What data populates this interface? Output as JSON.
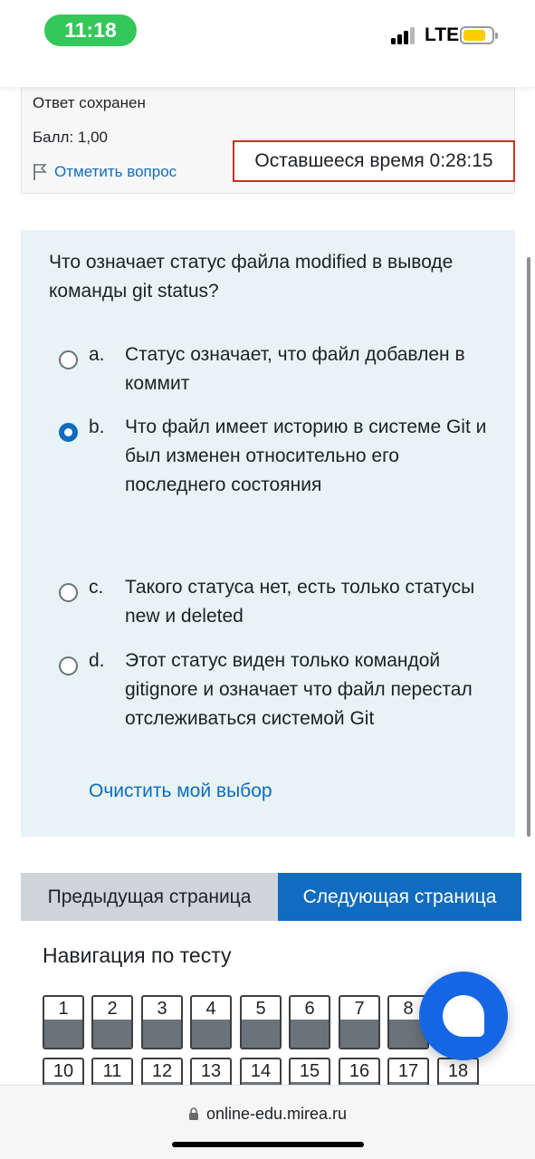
{
  "status_bar": {
    "time": "11:18",
    "network": "LTE",
    "accent_color": "#34c759",
    "battery_color": "#ffcc00"
  },
  "question_info": {
    "state": "Ответ сохранен",
    "grade": "Балл: 1,00",
    "flag_label": "Отметить вопрос",
    "flag_icon": "flag-icon"
  },
  "timer": {
    "label": "Оставшееся время 0:28:15"
  },
  "question": {
    "text": "Что означает статус файла modified в выводе команды git status?",
    "answers": [
      {
        "letter": "a.",
        "text": "Статус означает, что файл добавлен в коммит",
        "checked": false
      },
      {
        "letter": "b.",
        "text": "Что файл имеет историю в системе Git и был изменен относительно его последнего состояния",
        "checked": true
      },
      {
        "letter": "c.",
        "text": "Такого статуса нет, есть только статусы new и deleted",
        "checked": false
      },
      {
        "letter": "d.",
        "text": "Этот статус виден только командой gitignore и означает что файл перестал отслеживаться системой Git",
        "checked": false
      }
    ],
    "clear_label": "Очистить мой выбор"
  },
  "buttons": {
    "prev": "Предыдущая страница",
    "next": "Следующая страница"
  },
  "navigation": {
    "title": "Навигация по тесту",
    "items": [
      "1",
      "2",
      "3",
      "4",
      "5",
      "6",
      "7",
      "8",
      "10",
      "11",
      "12",
      "13",
      "14",
      "15",
      "16",
      "17",
      "18"
    ]
  },
  "browser": {
    "url": "online-edu.mirea.ru"
  },
  "colors": {
    "primary": "#0f6cbf",
    "timer_border": "#ca3120",
    "question_bg": "#e7f3f5"
  }
}
